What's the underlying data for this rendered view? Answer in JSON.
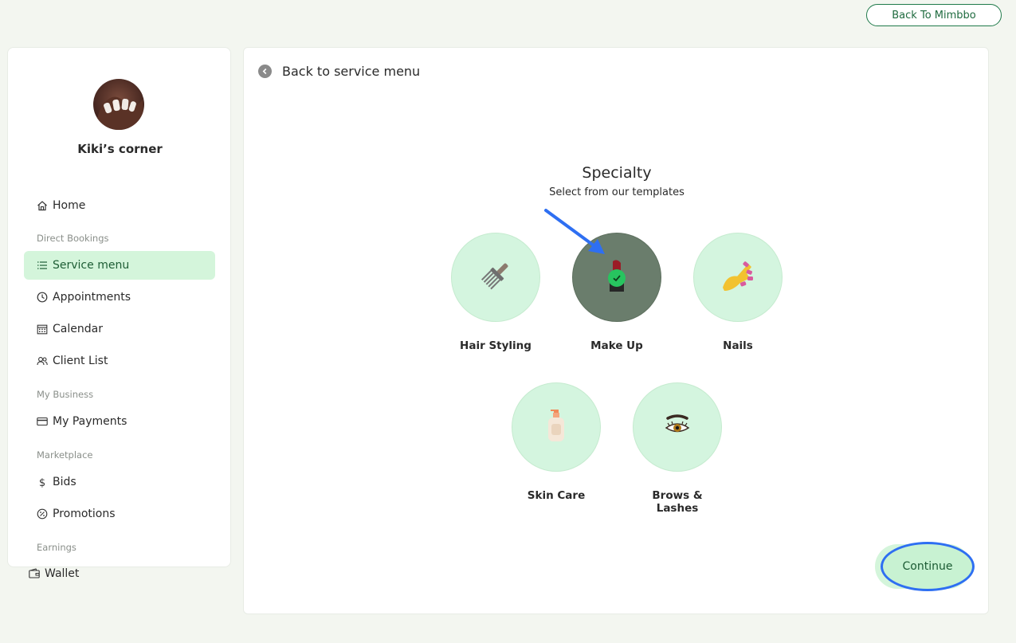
{
  "header": {
    "back_to_app_label": "Back To Mimbbo"
  },
  "profile": {
    "shop_name": "Kiki’s corner"
  },
  "sidebar": {
    "home": "Home",
    "section_direct_bookings": "Direct Bookings",
    "service_menu": "Service menu",
    "appointments": "Appointments",
    "calendar": "Calendar",
    "client_list": "Client List",
    "section_my_business": "My Business",
    "my_payments": "My Payments",
    "section_marketplace": "Marketplace",
    "bids": "Bids",
    "promotions": "Promotions",
    "section_earnings": "Earnings",
    "wallet": "Wallet"
  },
  "main": {
    "back_link": "Back to service menu",
    "title": "Specialty",
    "subtitle": "Select from our templates",
    "specialties": [
      {
        "label": "Hair Styling",
        "icon": "hair-pick-icon",
        "selected": false
      },
      {
        "label": "Make Up",
        "icon": "lipstick-icon",
        "selected": true
      },
      {
        "label": "Nails",
        "icon": "nail-polish-icon",
        "selected": false
      },
      {
        "label": "Skin Care",
        "icon": "lotion-bottle-icon",
        "selected": false
      },
      {
        "label": "Brows & Lashes",
        "icon": "eye-icon",
        "selected": false
      }
    ],
    "continue_label": "Continue"
  },
  "colors": {
    "accent_green": "#d4f5db",
    "selected_tile": "#6a7d6c",
    "annotation_blue": "#2e6ff2"
  }
}
